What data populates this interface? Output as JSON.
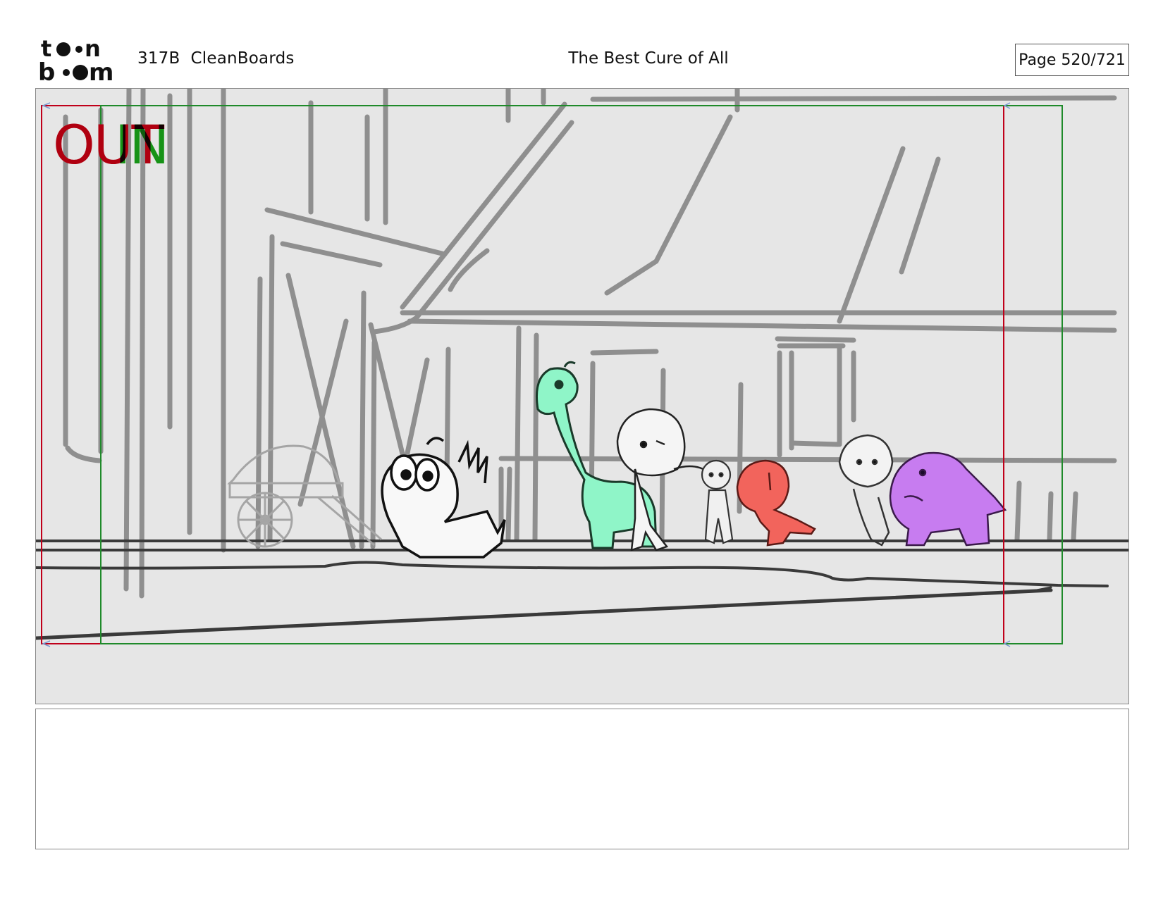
{
  "header": {
    "logo": {
      "icon": "toon-boom-logo",
      "line1": "to●n",
      "line2": "b●●m"
    },
    "scene_id": "317B  CleanBoards",
    "title": "The Best Cure of All",
    "page": "Page 520/721"
  },
  "panel": {
    "out_label": "OUT",
    "in_label": "IN",
    "colors": {
      "background": "#e6e6e6",
      "out_frame": "#c0001a",
      "in_frame": "#1f8a2a",
      "sketch_gray": "#8f8f8f",
      "ground": "#3a3a3a",
      "dino_green": "#8ff5c8",
      "creature_red": "#f2645c",
      "creature_purple": "#c77cf0"
    }
  },
  "caption": {
    "text": ""
  }
}
